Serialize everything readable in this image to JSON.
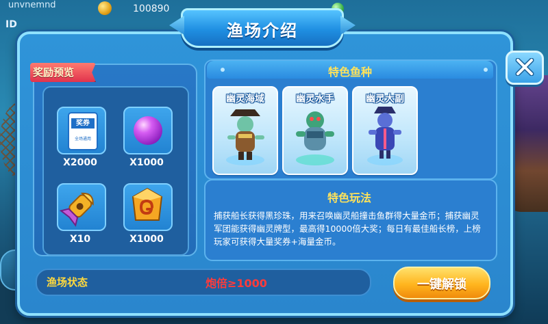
{
  "hud": {
    "username": "unvnemnd",
    "coins": "100890",
    "id_label": "ID"
  },
  "dialog": {
    "title": "渔场介绍",
    "close_icon": "close-x-icon"
  },
  "rewards": {
    "tag": "奖励预览",
    "items": [
      {
        "icon": "voucher-card-icon",
        "icon_text": "奖券",
        "icon_subtext": "全场通用",
        "amount": "X2000"
      },
      {
        "icon": "purple-pearl-icon",
        "amount": "X1000"
      },
      {
        "icon": "golden-torpedo-icon",
        "amount": "X10"
      },
      {
        "icon": "gold-lock-block-icon",
        "amount": "X1000"
      }
    ]
  },
  "fish": {
    "header": "特色鱼种",
    "cards": [
      {
        "name": "幽灵海域",
        "icon": "ghost-pirate-captain-icon"
      },
      {
        "name": "幽灵水手",
        "icon": "ghost-sailor-icon"
      },
      {
        "name": "幽灵大副",
        "icon": "ghost-first-mate-icon"
      }
    ]
  },
  "gameplay": {
    "title": "特色玩法",
    "description": "捕获船长获得黑珍珠，用来召唤幽灵船撞击鱼群得大量金币；捕获幽灵军团能获得幽灵牌型，最高得10000倍大奖；每日有最佳船长榜，上榜玩家可获得大量奖券+海量金币。"
  },
  "status": {
    "label": "渔场状态",
    "value": "炮倍≥1000"
  },
  "unlock_button": "一键解锁",
  "colors": {
    "title_yellow": "#ffe35a",
    "status_red": "#ff3b3b",
    "button_orange": "#ffb51e",
    "tag_red": "#e0334d"
  }
}
